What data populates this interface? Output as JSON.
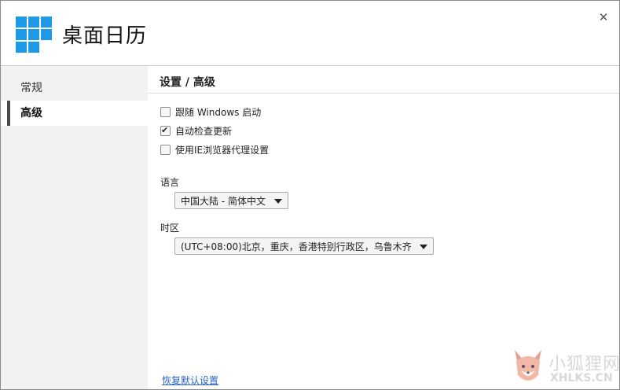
{
  "app": {
    "title": "桌面日历",
    "close_icon": "close-icon"
  },
  "sidebar": {
    "items": [
      {
        "label": "常规",
        "active": false
      },
      {
        "label": "高级",
        "active": true
      }
    ]
  },
  "main": {
    "section_title": "设置 / 高级",
    "options": [
      {
        "label": "跟随 Windows 启动",
        "checked": false
      },
      {
        "label": "自动检查更新",
        "checked": true
      },
      {
        "label": "使用IE浏览器代理设置",
        "checked": false
      }
    ],
    "language": {
      "label": "语言",
      "selected": "中国大陆 - 简体中文"
    },
    "timezone": {
      "label": "时区",
      "selected": "(UTC+08:00)北京，重庆，香港特别行政区，乌鲁木齐"
    },
    "restore_defaults": "恢复默认设置"
  },
  "watermark": {
    "text_cn": "小狐狸网",
    "text_en": "XHLKS.CN"
  },
  "colors": {
    "logo_blue": "#1e9be6",
    "link_blue": "#2a63c6",
    "sidebar_bg": "#f2f2f2"
  }
}
